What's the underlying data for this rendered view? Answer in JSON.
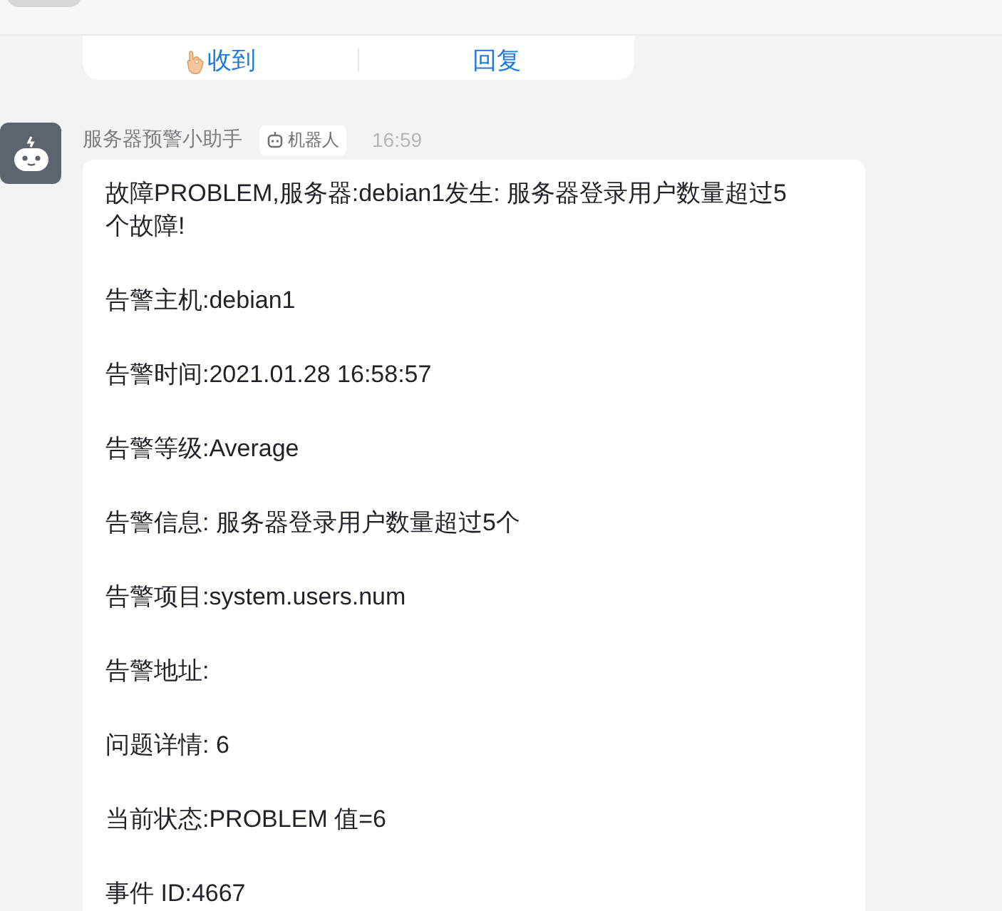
{
  "action_card": {
    "buttons": [
      {
        "label": "收到",
        "icon": true
      },
      {
        "label": "回复",
        "icon": false
      }
    ]
  },
  "message": {
    "sender": "服务器预警小助手",
    "badge": "机器人",
    "time": "16:59",
    "paragraphs": [
      "故障PROBLEM,服务器:debian1发生: 服务器登录用户数量超过5个故障!",
      "告警主机:debian1",
      "告警时间:2021.01.28 16:58:57",
      "告警等级:Average",
      "告警信息: 服务器登录用户数量超过5个",
      "告警项目:system.users.num",
      "告警地址:",
      "问题详情: 6",
      "当前状态:PROBLEM  值=6",
      "事件 ID:4667"
    ]
  }
}
